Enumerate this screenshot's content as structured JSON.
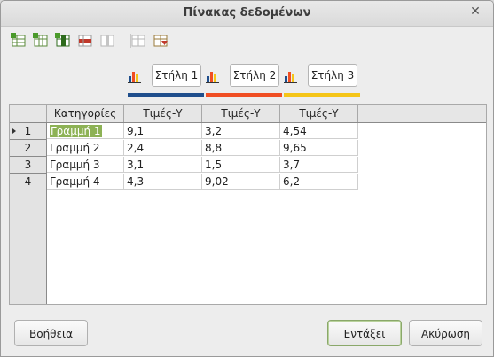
{
  "window": {
    "title": "Πίνακας δεδομένων"
  },
  "toolbar": {
    "items": [
      {
        "name": "insert-row-icon",
        "color": "#4a8a2a"
      },
      {
        "name": "insert-series-icon",
        "color": "#4a8a2a"
      },
      {
        "name": "insert-text-column-icon",
        "color": "#2d6b1c"
      },
      {
        "name": "delete-row-icon",
        "color": "#c0392b"
      },
      {
        "name": "delete-series-icon",
        "color": "#9a9a9a"
      },
      {
        "name": "move-series-left-icon",
        "color": "#9a9a9a"
      },
      {
        "name": "move-row-down-icon",
        "color": "#c0392b"
      }
    ]
  },
  "series": [
    {
      "label": "Στήλη 1",
      "color": "#1f4e8c"
    },
    {
      "label": "Στήλη 2",
      "color": "#f04e23"
    },
    {
      "label": "Στήλη 3",
      "color": "#f5c518"
    }
  ],
  "table": {
    "headers": [
      "Κατηγορίες",
      "Τιμές-Υ",
      "Τιμές-Υ",
      "Τιμές-Υ"
    ],
    "rows": [
      {
        "num": "1",
        "category": "Γραμμή 1",
        "values": [
          "9,1",
          "3,2",
          "4,54"
        ]
      },
      {
        "num": "2",
        "category": "Γραμμή 2",
        "values": [
          "2,4",
          "8,8",
          "9,65"
        ]
      },
      {
        "num": "3",
        "category": "Γραμμή 3",
        "values": [
          "3,1",
          "1,5",
          "3,7"
        ]
      },
      {
        "num": "4",
        "category": "Γραμμή 4",
        "values": [
          "4,3",
          "9,02",
          "6,2"
        ]
      }
    ]
  },
  "buttons": {
    "help": "Βοήθεια",
    "insert": "Εντάξει",
    "cancel": "Ακύρωση"
  },
  "close_glyph": "✕"
}
